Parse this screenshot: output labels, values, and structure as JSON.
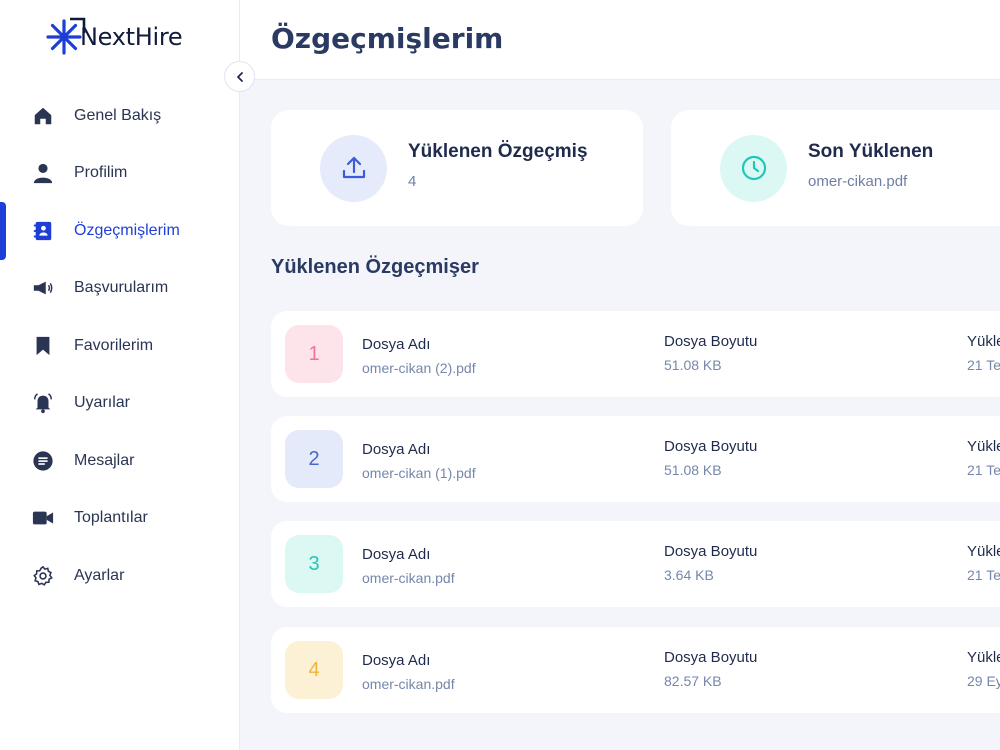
{
  "brand": {
    "name": "NextHire",
    "accent": "#1d3fd8"
  },
  "header": {
    "title": "Özgeçmişlerim"
  },
  "sidebar": {
    "items": [
      {
        "label": "Genel Bakış",
        "icon": "home-icon",
        "active": false
      },
      {
        "label": "Profilim",
        "icon": "user-icon",
        "active": false
      },
      {
        "label": "Özgeçmişlerim",
        "icon": "resume-icon",
        "active": true
      },
      {
        "label": "Başvurularım",
        "icon": "megaphone-icon",
        "active": false
      },
      {
        "label": "Favorilerim",
        "icon": "bookmark-icon",
        "active": false
      },
      {
        "label": "Uyarılar",
        "icon": "bell-icon",
        "active": false
      },
      {
        "label": "Mesajlar",
        "icon": "message-icon",
        "active": false
      },
      {
        "label": "Toplantılar",
        "icon": "video-icon",
        "active": false
      },
      {
        "label": "Ayarlar",
        "icon": "gear-icon",
        "active": false
      }
    ]
  },
  "stats": [
    {
      "title": "Yüklenen Özgeçmiş",
      "value": "4",
      "icon": "upload-icon",
      "color": "#3b5bdb",
      "bg": "#e6ebfb"
    },
    {
      "title": "Son Yüklenen",
      "value": "omer-cikan.pdf",
      "icon": "clock-icon",
      "color": "#1ec8b4",
      "bg": "#dcf8f4"
    }
  ],
  "section": {
    "title": "Yüklenen Özgeçmişer"
  },
  "resumes": [
    {
      "num": "1",
      "name_label": "Dosya Adı",
      "name": "omer-cikan (2).pdf",
      "size_label": "Dosya Boyutu",
      "size": "51.08 KB",
      "date_label": "Yükle",
      "date": "21 Te",
      "color": "#f27394",
      "bg": "#fde3ea"
    },
    {
      "num": "2",
      "name_label": "Dosya Adı",
      "name": "omer-cikan (1).pdf",
      "size_label": "Dosya Boyutu",
      "size": "51.08 KB",
      "date_label": "Yükle",
      "date": "21 Te",
      "color": "#4a66c9",
      "bg": "#e5eafb"
    },
    {
      "num": "3",
      "name_label": "Dosya Adı",
      "name": "omer-cikan.pdf",
      "size_label": "Dosya Boyutu",
      "size": "3.64 KB",
      "date_label": "Yükle",
      "date": "21 Te",
      "color": "#25c7b3",
      "bg": "#dcf8f3"
    },
    {
      "num": "4",
      "name_label": "Dosya Adı",
      "name": "omer-cikan.pdf",
      "size_label": "Dosya Boyutu",
      "size": "82.57 KB",
      "date_label": "Yükle",
      "date": "29 Ey",
      "color": "#f0b43a",
      "bg": "#fdf1d5"
    }
  ]
}
